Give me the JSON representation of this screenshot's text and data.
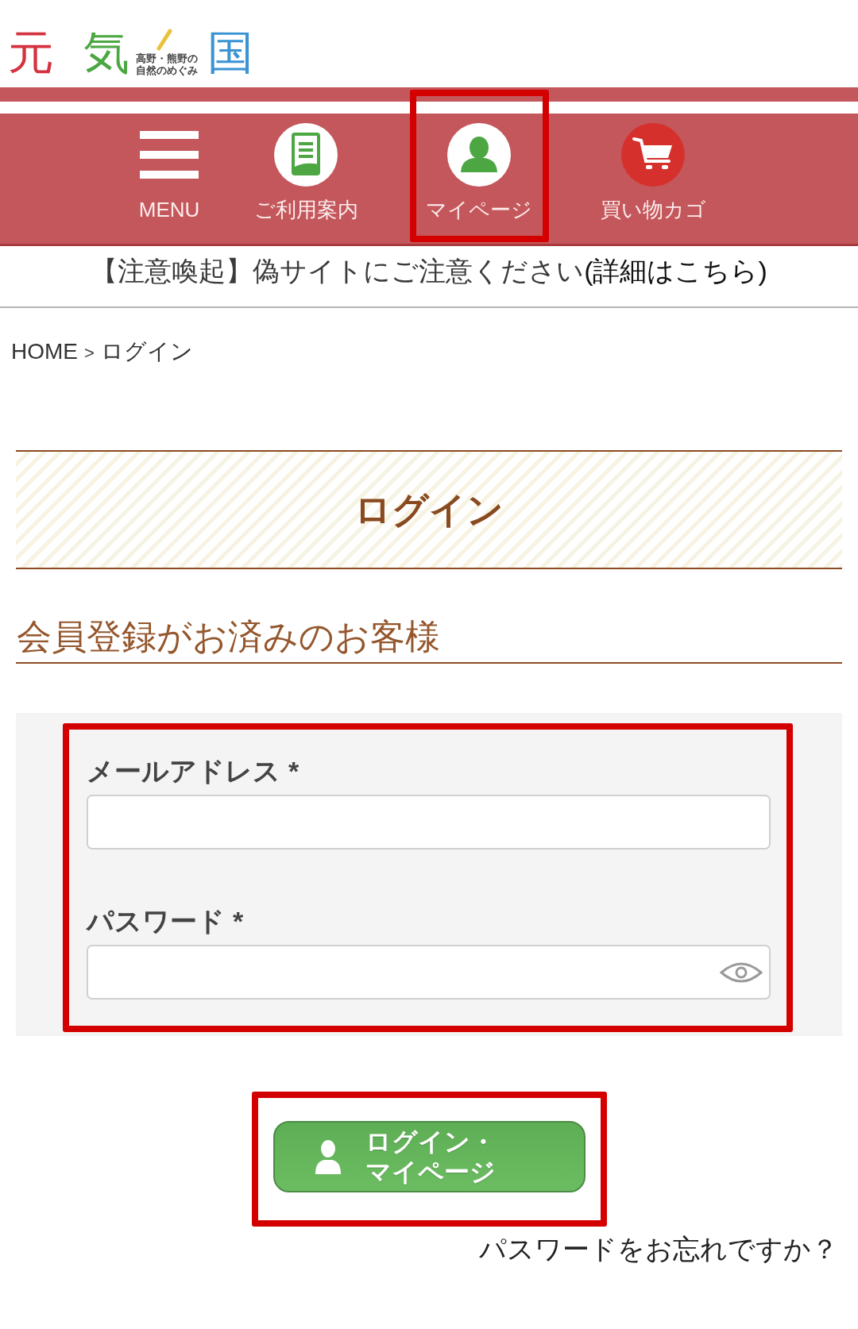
{
  "logo": {
    "chars": [
      {
        "text": "元",
        "color": "#d4323f"
      },
      {
        "text": "気",
        "color": "#4ca743"
      },
      {
        "text": "国",
        "color": "#3b93d3"
      }
    ],
    "tagline": [
      "高野・熊野の",
      "自然のめぐみ"
    ]
  },
  "nav": [
    {
      "kind": "menu",
      "label": "MENU",
      "highlighted": false
    },
    {
      "kind": "guide",
      "label": "ご利用案内",
      "highlighted": false
    },
    {
      "kind": "mypage",
      "label": "マイページ",
      "highlighted": true
    },
    {
      "kind": "cart",
      "label": "買い物カゴ",
      "highlighted": false
    }
  ],
  "notice": {
    "text": "【注意喚起】偽サイトにご注意ください",
    "link": "(詳細はこちら)"
  },
  "breadcrumb": {
    "items": [
      "HOME",
      "ログイン"
    ],
    "separator": ">"
  },
  "page_title": "ログイン",
  "section_title": "会員登録がお済みのお客様",
  "login_form": {
    "highlighted": true,
    "fields": [
      {
        "kind": "email",
        "label": "メールアドレス",
        "required_mark": "*"
      },
      {
        "kind": "password",
        "label": "パスワード",
        "required_mark": "*"
      }
    ]
  },
  "login_button": {
    "label": "ログイン・マイページ",
    "highlighted": true
  },
  "forgot_password_link": "パスワードをお忘れですか？"
}
